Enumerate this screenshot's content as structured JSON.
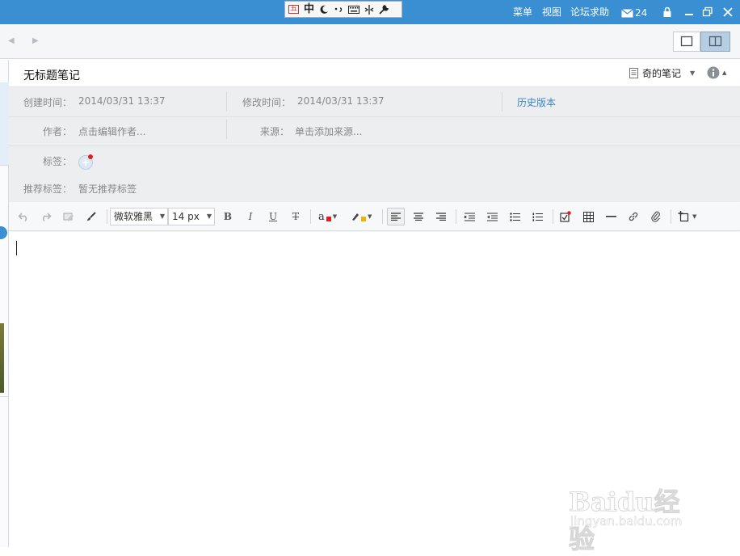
{
  "ime_bar": {
    "mode_badge": "五",
    "lang": "中",
    "icons": [
      "moon-icon",
      "punctuation-icon",
      "keyboard-icon",
      "split-icon",
      "wrench-icon"
    ]
  },
  "topbar": {
    "menu_label": "菜单",
    "view_label": "视图",
    "forum_label": "论坛求助",
    "mail_count": "24"
  },
  "note": {
    "title": "无标题笔记",
    "notebook": "奇的笔记"
  },
  "meta": {
    "created_label": "创建时间：",
    "created_value": "2014/03/31 13:37",
    "modified_label": "修改时间：",
    "modified_value": "2014/03/31 13:37",
    "history_link": "历史版本",
    "author_label": "作者：",
    "author_placeholder": "点击编辑作者...",
    "source_label": "来源：",
    "source_placeholder": "单击添加来源...",
    "tags_label": "标签：",
    "recommend_label": "推荐标签：",
    "recommend_value": "暂无推荐标签"
  },
  "toolbar": {
    "font_family": "微软雅黑",
    "font_size": "14 px",
    "bold": "B",
    "italic": "I",
    "underline": "U",
    "strike": "T",
    "font_color_glyph": "a"
  },
  "colors": {
    "accent": "#3a8fd2",
    "link": "#3a86c8",
    "font_color_swatch": "#e02020",
    "highlight_swatch": "#f0b400"
  },
  "watermark": {
    "brand": "Baidu经验",
    "url": "jingyan.baidu.com"
  }
}
